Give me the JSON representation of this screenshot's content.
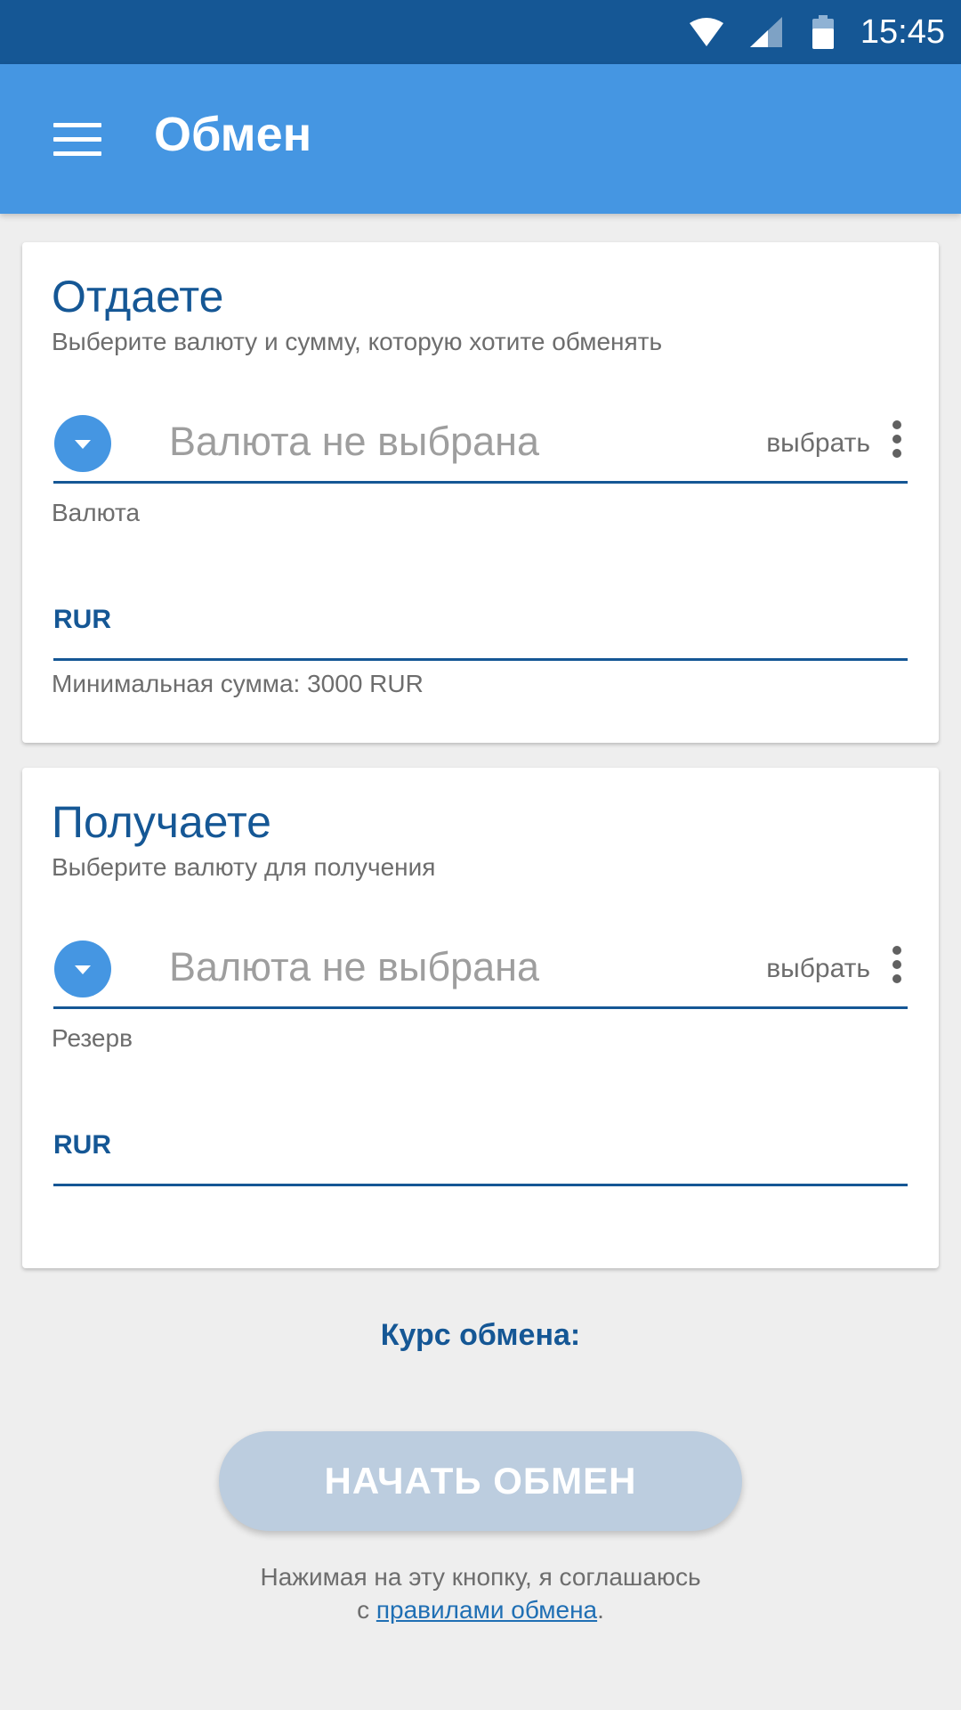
{
  "status_bar": {
    "time": "15:45"
  },
  "app_bar": {
    "title": "Обмен",
    "menu_icon": "menu-icon"
  },
  "give_card": {
    "title": "Отдаете",
    "subtitle": "Выберите валюту и сумму, которую хотите обменять",
    "currency_placeholder": "Валюта не выбрана",
    "choose_label": "выбрать",
    "field_label": "Валюта",
    "amount_currency": "RUR",
    "helper": "Минимальная сумма: 3000 RUR"
  },
  "receive_card": {
    "title": "Получаете",
    "subtitle": "Выберите валюту для получения",
    "currency_placeholder": "Валюта не выбрана",
    "choose_label": "выбрать",
    "field_label": "Резерв",
    "amount_currency": "RUR"
  },
  "exchange_rate_label": "Курс обмена:",
  "start_button": "НАЧАТЬ ОБМЕН",
  "consent": {
    "line1": "Нажимая на эту кнопку, я соглашаюсь",
    "prefix": "с",
    "link": "правилами обмена",
    "suffix": "."
  },
  "colors": {
    "status_bar": "#155795",
    "app_bar": "#4596e2",
    "accent_dark": "#155795",
    "button_disabled": "#bccddf"
  }
}
